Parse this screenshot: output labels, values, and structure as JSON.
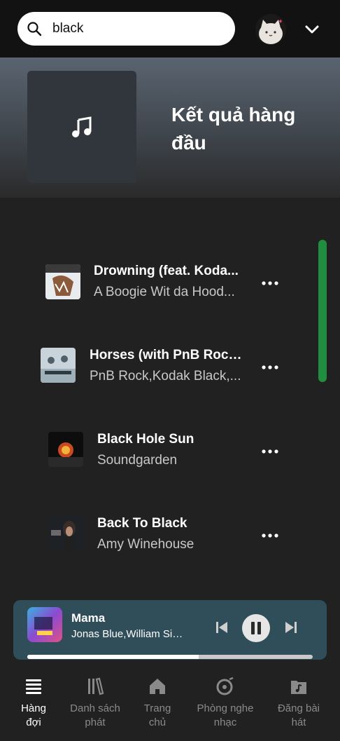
{
  "search": {
    "value": "black",
    "icon": "search-icon"
  },
  "header": {
    "account_icon": "avatar",
    "menu_icon": "chevron-down-icon"
  },
  "hero": {
    "title": "Kết quả hàng đầu",
    "icon": "music-note-icon"
  },
  "tracks": [
    {
      "title": "Drowning (feat. Koda...",
      "artist": "A Boogie Wit da Hood..."
    },
    {
      "title": "Horses (with PnB Rock...",
      "artist": "PnB Rock,Kodak Black,..."
    },
    {
      "title": "Black Hole Sun",
      "artist": "Soundgarden"
    },
    {
      "title": "Back To Black",
      "artist": "Amy Winehouse"
    }
  ],
  "player": {
    "title": "Mama",
    "artist": "Jonas Blue,William Sin...",
    "progress": 0.6,
    "colors": {
      "background": "#2f4e5a"
    }
  },
  "nav": {
    "items": [
      {
        "label": "Hàng đợi",
        "icon": "queue-icon",
        "active": true
      },
      {
        "label": "Danh sách phát",
        "icon": "library-icon",
        "active": false
      },
      {
        "label": "Trang chủ",
        "icon": "home-icon",
        "active": false
      },
      {
        "label": "Phòng nghe nhạc",
        "icon": "listening-room-icon",
        "active": false
      },
      {
        "label": "Đăng bài hát",
        "icon": "upload-song-icon",
        "active": false
      }
    ]
  },
  "colors": {
    "accent": "#1f8f3f",
    "background": "#212121",
    "topbar": "#121212"
  }
}
